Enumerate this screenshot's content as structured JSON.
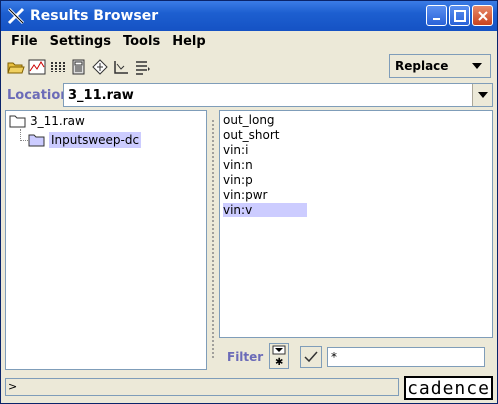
{
  "window": {
    "title": "Results Browser"
  },
  "menu": [
    "File",
    "Settings",
    "Tools",
    "Help"
  ],
  "toolbar": {
    "icons": [
      "open-folder-icon",
      "graph-icon",
      "columns-icon",
      "calculator-icon",
      "diamond-icon",
      "axis-icon",
      "list-icon"
    ],
    "mode_value": "Replace"
  },
  "location": {
    "label": "Location",
    "value": "3_11.raw"
  },
  "tree": {
    "root": "3_11.raw",
    "child": "Inputsweep-dc"
  },
  "signals": [
    "out_long",
    "out_short",
    "vin:i",
    "vin:n",
    "vin:p",
    "vin:pwr",
    "vin:v"
  ],
  "selected_signal": "vin:v",
  "filter": {
    "label": "Filter",
    "value": "*"
  },
  "status": {
    "prompt": ">"
  },
  "logo": "cadence",
  "colors": {
    "selection": "#ccccff",
    "title_bar": "#1d5fd0",
    "label_accent": "#6b6bb8"
  }
}
